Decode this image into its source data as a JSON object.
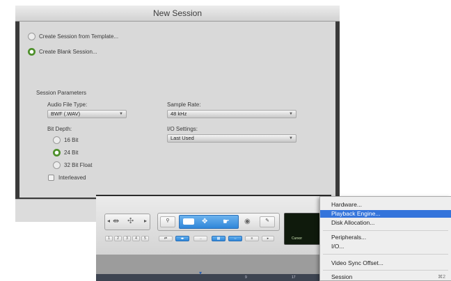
{
  "dialog": {
    "title": "New Session",
    "create_from_template": "Create Session from Template...",
    "create_blank": "Create Blank Session...",
    "session_parameters": "Session Parameters",
    "audio_file_type": {
      "label": "Audio File Type:",
      "value": "BWF (.WAV)"
    },
    "sample_rate": {
      "label": "Sample Rate:",
      "value": "48 kHz"
    },
    "bit_depth": {
      "label": "Bit Depth:",
      "options": [
        "16 Bit",
        "24 Bit",
        "32 Bit Float"
      ],
      "selected": "24 Bit"
    },
    "io_settings": {
      "label": "I/O Settings:",
      "value": "Last Used"
    },
    "interleaved": "Interleaved"
  },
  "toolbar": {
    "zoom_presets": [
      "1",
      "2",
      "3",
      "4",
      "5"
    ],
    "counter_label": "Cursor"
  },
  "ruler": {
    "markers": [
      "9",
      "17"
    ]
  },
  "menu": {
    "items": [
      {
        "label": "Hardware...",
        "shortcut": ""
      },
      {
        "label": "Playback Engine...",
        "shortcut": ""
      },
      {
        "label": "Disk Allocation...",
        "shortcut": ""
      },
      {
        "label": "Peripherals...",
        "shortcut": ""
      },
      {
        "label": "I/O...",
        "shortcut": ""
      },
      {
        "label": "Video Sync Offset...",
        "shortcut": ""
      },
      {
        "label": "Session",
        "shortcut": "⌘2"
      }
    ],
    "highlighted": "Playback Engine..."
  },
  "colors": {
    "accent_green": "#4d8f2a",
    "menu_highlight": "#3474db",
    "toolbar_blue": "#2f86d9"
  }
}
